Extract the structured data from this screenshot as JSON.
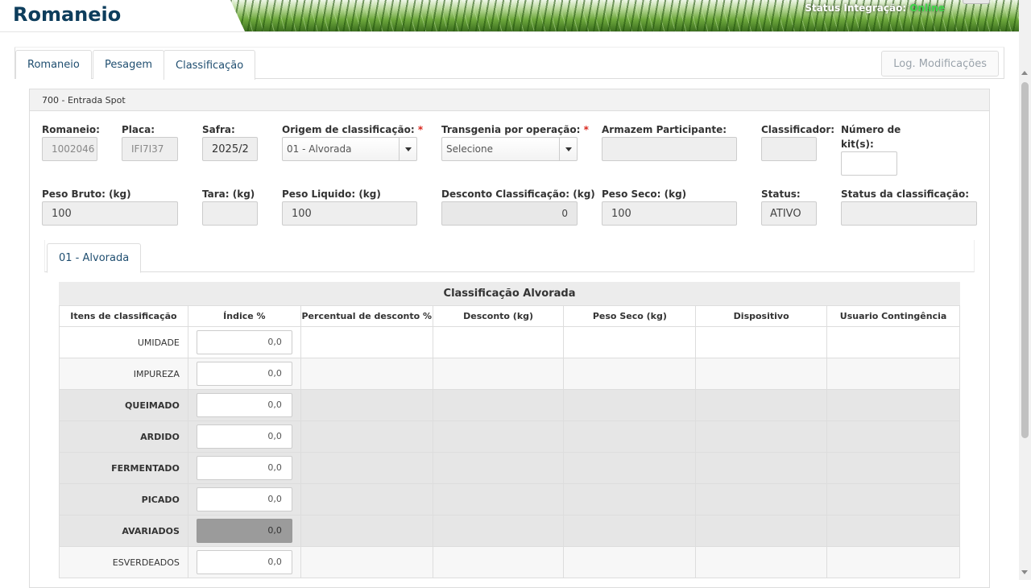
{
  "header": {
    "title": "Romaneio",
    "status_label": "Status Integração:",
    "status_value": "Online"
  },
  "tabs": [
    {
      "label": "Romaneio"
    },
    {
      "label": "Pesagem"
    },
    {
      "label": "Classificação"
    }
  ],
  "log_button": "Log. Modificações",
  "panel_title": "700 - Entrada Spot",
  "fields": {
    "romaneio": {
      "label": "Romaneio:",
      "value": "1002046"
    },
    "placa": {
      "label": "Placa:",
      "value": "IFI7I37"
    },
    "safra": {
      "label": "Safra:",
      "value": "2025/2"
    },
    "origem": {
      "label": "Origem de classificação:",
      "value": "01 - Alvorada"
    },
    "transgenia": {
      "label": "Transgenia por operação:",
      "value": "Selecione"
    },
    "armazem": {
      "label": "Armazem Participante:",
      "value": ""
    },
    "classificador": {
      "label": "Classificador:",
      "value": ""
    },
    "num_kits": {
      "label": "Número de kit(s):",
      "value": ""
    },
    "peso_bruto": {
      "label": "Peso Bruto: (kg)",
      "value": "100"
    },
    "tara": {
      "label": "Tara: (kg)",
      "value": ""
    },
    "peso_liquido": {
      "label": "Peso Liquido: (kg)",
      "value": "100"
    },
    "desconto": {
      "label": "Desconto Classificação: (kg)",
      "value": "0"
    },
    "peso_seco": {
      "label": "Peso Seco: (kg)",
      "value": "100"
    },
    "status": {
      "label": "Status:",
      "value": "ATIVO"
    },
    "status_class": {
      "label": "Status da classificação:",
      "value": ""
    }
  },
  "required_mark": "*",
  "inner_tab": "01 - Alvorada",
  "table": {
    "caption": "Classificação Alvorada",
    "headers": [
      "Itens de classificação",
      "Índice %",
      "Percentual de desconto %",
      "Desconto (kg)",
      "Peso Seco (kg)",
      "Dispositivo",
      "Usuario Contingência"
    ],
    "rows": [
      {
        "item": "UMIDADE",
        "indice": "0,0"
      },
      {
        "item": "IMPUREZA",
        "indice": "0,0"
      },
      {
        "item": "QUEIMADO",
        "indice": "0,0"
      },
      {
        "item": "ARDIDO",
        "indice": "0,0"
      },
      {
        "item": "FERMENTADO",
        "indice": "0,0"
      },
      {
        "item": "PICADO",
        "indice": "0,0"
      },
      {
        "item": "AVARIADOS",
        "indice": "0,0"
      },
      {
        "item": "ESVERDEADOS",
        "indice": "0,0"
      }
    ]
  }
}
